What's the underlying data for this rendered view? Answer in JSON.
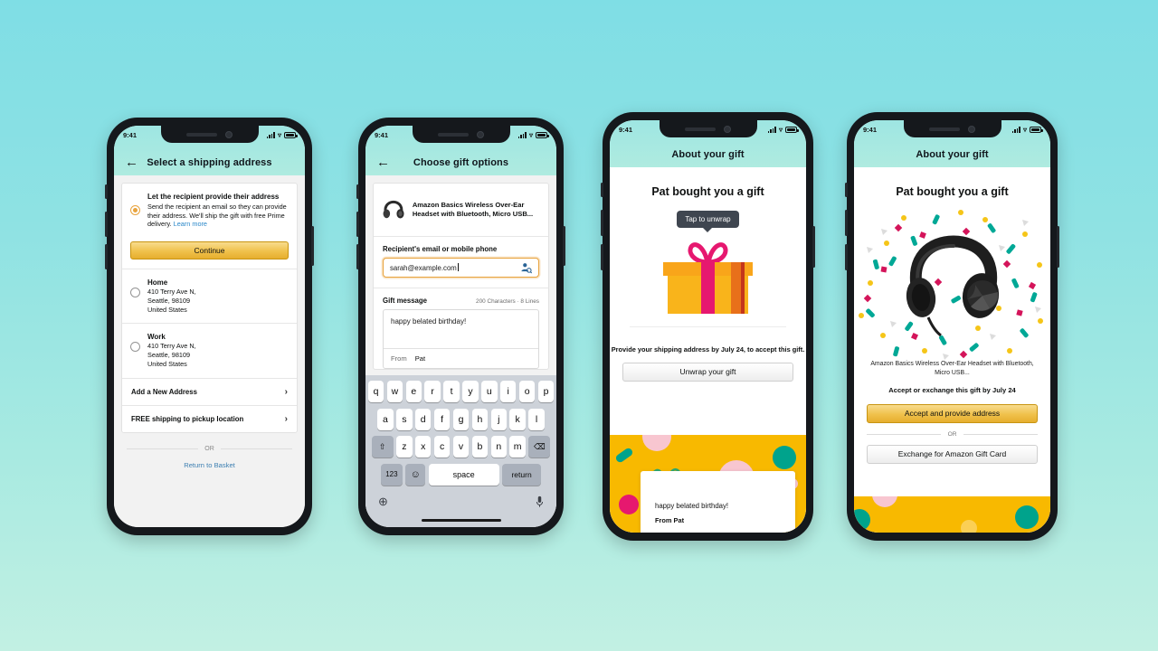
{
  "background": {
    "gradient_top": "#7FDEE5",
    "gradient_bottom": "#C2F0E3"
  },
  "status_bar": {
    "time": "9:41",
    "signal": "signal-bars",
    "wifi": "wifi-icon",
    "battery": "battery-icon"
  },
  "phones": [
    {
      "id": "select-shipping-address",
      "appbar": {
        "back": "←",
        "title": "Select a shipping address"
      },
      "option": {
        "title": "Let the recipient provide their address",
        "desc": "Send the recipient an email so they can provide their address. We'll ship the gift with free Prime delivery.",
        "link": "Learn more",
        "button": "Continue",
        "selected": true
      },
      "addresses": [
        {
          "name": "Home",
          "line1": "410 Terry Ave N,",
          "line2": "Seattle, 98109",
          "line3": "United States",
          "selected": false
        },
        {
          "name": "Work",
          "line1": "410 Terry Ave N,",
          "line2": "Seattle, 98109",
          "line3": "United States",
          "selected": false
        }
      ],
      "links": [
        {
          "label": "Add a New Address"
        },
        {
          "label": "FREE shipping to pickup location"
        }
      ],
      "or_text": "OR",
      "basket_link": "Return to Basket"
    },
    {
      "id": "choose-gift-options",
      "appbar": {
        "back": "←",
        "title": "Choose gift options"
      },
      "product": {
        "title": "Amazon Basics Wireless Over-Ear Headset with Bluetooth, Micro USB..."
      },
      "recipient": {
        "label": "Recipient's email or mobile phone",
        "value": "sarah@example.com",
        "contacts_icon": "contacts-lookup-icon"
      },
      "gift_message": {
        "label": "Gift message",
        "counter": "200 Characters · 8 Lines",
        "value": "happy belated birthday!",
        "from_label": "From",
        "from_value": "Pat"
      },
      "keyboard": {
        "row1": [
          "q",
          "w",
          "e",
          "r",
          "t",
          "y",
          "u",
          "i",
          "o",
          "p"
        ],
        "row2": [
          "a",
          "s",
          "d",
          "f",
          "g",
          "h",
          "j",
          "k",
          "l"
        ],
        "row3": [
          "z",
          "x",
          "c",
          "v",
          "b",
          "n",
          "m"
        ],
        "shift": "⇧",
        "backspace": "⌫",
        "numbers": "123",
        "emoji": "☺",
        "space": "space",
        "return": "return",
        "globe": "⊕",
        "mic": "mic-icon"
      }
    },
    {
      "id": "about-your-gift-wrapped",
      "appbar": {
        "title": "About your gift"
      },
      "heading": "Pat bought you a gift",
      "tooltip": "Tap to unwrap",
      "gift_icon": "gift-box-icon",
      "info": "Provide your shipping address by July 24, to accept this gift.",
      "button": "Unwrap your gift",
      "note": {
        "message": "happy belated birthday!",
        "from": "From Pat"
      }
    },
    {
      "id": "about-your-gift-revealed",
      "appbar": {
        "title": "About your gift"
      },
      "heading": "Pat bought you a gift",
      "product_image": "headphones-image",
      "product_desc": "Amazon Basics Wireless Over-Ear Headset with Bluetooth, Micro USB...",
      "deadline": "Accept or exchange this gift by July 24",
      "primary_button": "Accept and provide address",
      "or_text": "OR",
      "secondary_button": "Exchange for Amazon Gift Card"
    }
  ],
  "colors": {
    "amazon_yellow": "#F0C14B",
    "confetti_yellow": "#F8B900",
    "teal": "#00A896",
    "crimson": "#D4145A",
    "pink": "#F8C6D0",
    "gift_pink": "#E6186F",
    "link_blue": "#2987c9"
  }
}
